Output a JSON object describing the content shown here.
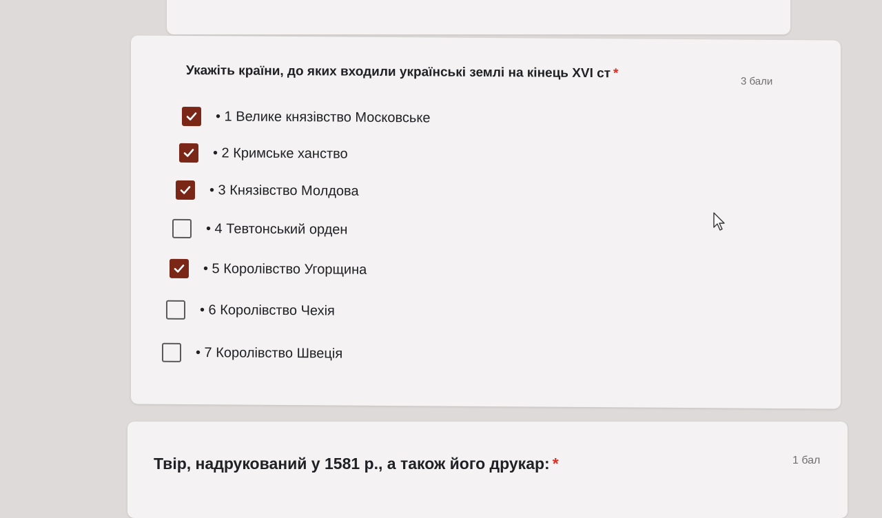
{
  "question1": {
    "title": "Укажіть країни, до яких входили українські землі на кінець XVI ст",
    "required_mark": "*",
    "points": "3 бали",
    "options": [
      {
        "label": "• 1 Велике князівство Московське",
        "checked": true
      },
      {
        "label": "• 2 Кримське ханство",
        "checked": true
      },
      {
        "label": "• 3 Князівство Молдова",
        "checked": true
      },
      {
        "label": "• 4 Тевтонський орден",
        "checked": false
      },
      {
        "label": "• 5 Королівство Угорщина",
        "checked": true
      },
      {
        "label": "• 6 Королівство Чехія",
        "checked": false
      },
      {
        "label": "• 7 Королівство Швеція",
        "checked": false
      }
    ]
  },
  "question2": {
    "title": "Твір, надрукований у 1581 р., а також його друкар:",
    "required_mark": "*",
    "points": "1 бал"
  },
  "colors": {
    "checkbox_checked": "#7a2717",
    "required": "#d93025"
  }
}
